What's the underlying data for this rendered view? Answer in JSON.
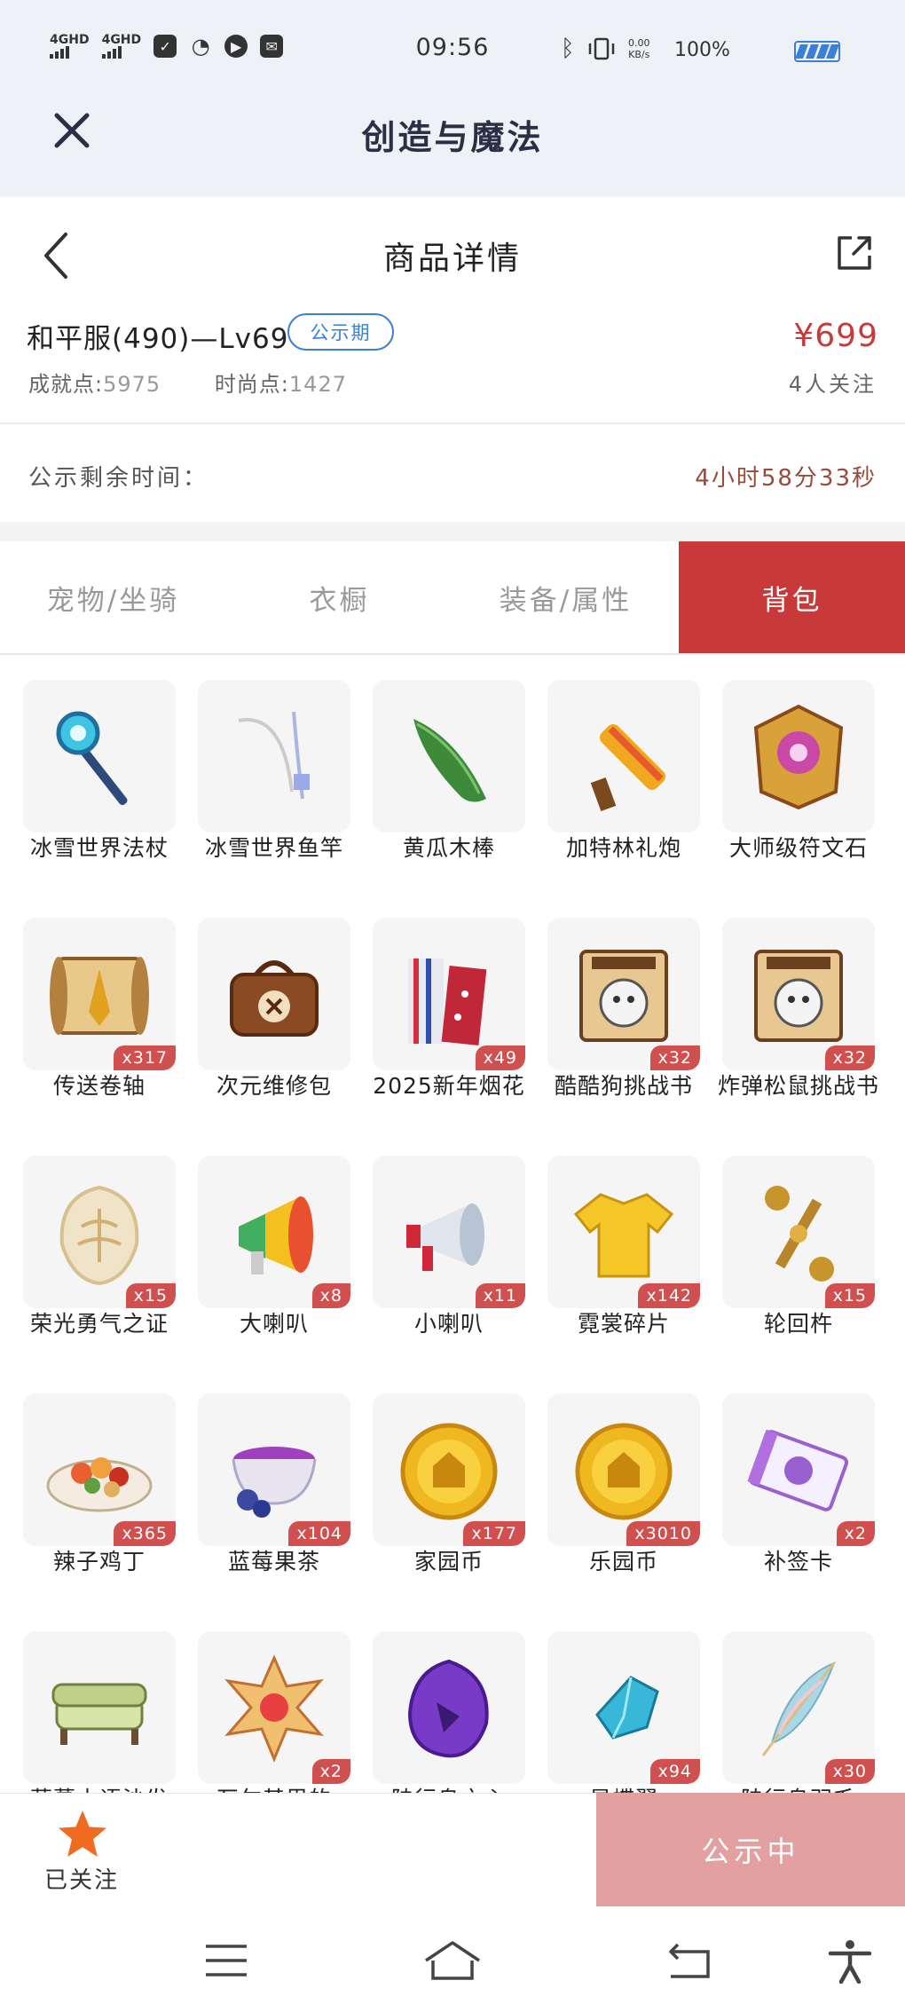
{
  "status_bar": {
    "sim1": "4GHD",
    "sim2": "4GHD",
    "time": "09:56",
    "net_speed_value": "0.00",
    "net_speed_unit": "KB/s",
    "battery": "100%",
    "icons": [
      "check-icon",
      "wechat-icon",
      "play-icon",
      "mail-icon",
      "bluetooth-icon",
      "vibrate-icon"
    ]
  },
  "app_bar": {
    "title": "创造与魔法"
  },
  "nav": {
    "title": "商品详情"
  },
  "product": {
    "name": "和平服(490)—Lv69",
    "badge": "公示期",
    "price": "¥699",
    "achievement_label": "成就点:",
    "achievement_value": "5975",
    "fashion_label": "时尚点:",
    "fashion_value": "1427",
    "followers": "4人关注"
  },
  "remaining": {
    "label": "公示剩余时间：",
    "value": "4小时58分33秒"
  },
  "tabs": [
    {
      "label": "宠物/坐骑",
      "active": false
    },
    {
      "label": "衣橱",
      "active": false
    },
    {
      "label": "装备/属性",
      "active": false
    },
    {
      "label": "背包",
      "active": true
    }
  ],
  "items": [
    {
      "name": "冰雪世界法杖",
      "qty": "",
      "icon": "staff-icon"
    },
    {
      "name": "冰雪世界鱼竿",
      "qty": "",
      "icon": "fishing-rod-icon"
    },
    {
      "name": "黄瓜木棒",
      "qty": "",
      "icon": "cucumber-icon"
    },
    {
      "name": "加特林礼炮",
      "qty": "",
      "icon": "cannon-icon"
    },
    {
      "name": "大师级符文石",
      "qty": "",
      "icon": "rune-stone-icon"
    },
    {
      "name": "传送卷轴",
      "qty": "x317",
      "icon": "scroll-icon"
    },
    {
      "name": "次元维修包",
      "qty": "",
      "icon": "repair-bag-icon"
    },
    {
      "name": "2025新年烟花",
      "qty": "x49",
      "icon": "firework-icon"
    },
    {
      "name": "酷酷狗挑战书",
      "qty": "x32",
      "icon": "wanted-poster-icon"
    },
    {
      "name": "炸弹松鼠挑战书",
      "qty": "x32",
      "icon": "wanted-poster-icon"
    },
    {
      "name": "荣光勇气之证",
      "qty": "x15",
      "icon": "emblem-icon"
    },
    {
      "name": "大喇叭",
      "qty": "x8",
      "icon": "megaphone-icon"
    },
    {
      "name": "小喇叭",
      "qty": "x11",
      "icon": "megaphone-small-icon"
    },
    {
      "name": "霓裳碎片",
      "qty": "x142",
      "icon": "shirt-icon"
    },
    {
      "name": "轮回杵",
      "qty": "x15",
      "icon": "pestle-icon"
    },
    {
      "name": "辣子鸡丁",
      "qty": "x365",
      "icon": "dish-icon"
    },
    {
      "name": "蓝莓果茶",
      "qty": "x104",
      "icon": "tea-icon"
    },
    {
      "name": "家园币",
      "qty": "x177",
      "icon": "coin-icon"
    },
    {
      "name": "乐园币",
      "qty": "x3010",
      "icon": "coin-icon"
    },
    {
      "name": "补签卡",
      "qty": "x2",
      "icon": "card-icon"
    },
    {
      "name": "藤蔓木语沙发",
      "qty": "",
      "icon": "sofa-icon"
    },
    {
      "name": "瓦尔基里的",
      "qty": "x2",
      "icon": "crest-icon"
    },
    {
      "name": "陆行鸟之心",
      "qty": "",
      "icon": "gem-icon"
    },
    {
      "name": "星蝶翼",
      "qty": "x94",
      "icon": "crystal-icon"
    },
    {
      "name": "陆行鸟羽毛",
      "qty": "x30",
      "icon": "feather-icon"
    }
  ],
  "bottom": {
    "followed_label": "已关注",
    "publish_label": "公示中"
  },
  "colors": {
    "accent": "#c8393a",
    "badge_blue": "#3b7fd9",
    "publish_btn": "#e2a0a0",
    "star": "#f06a1f"
  }
}
